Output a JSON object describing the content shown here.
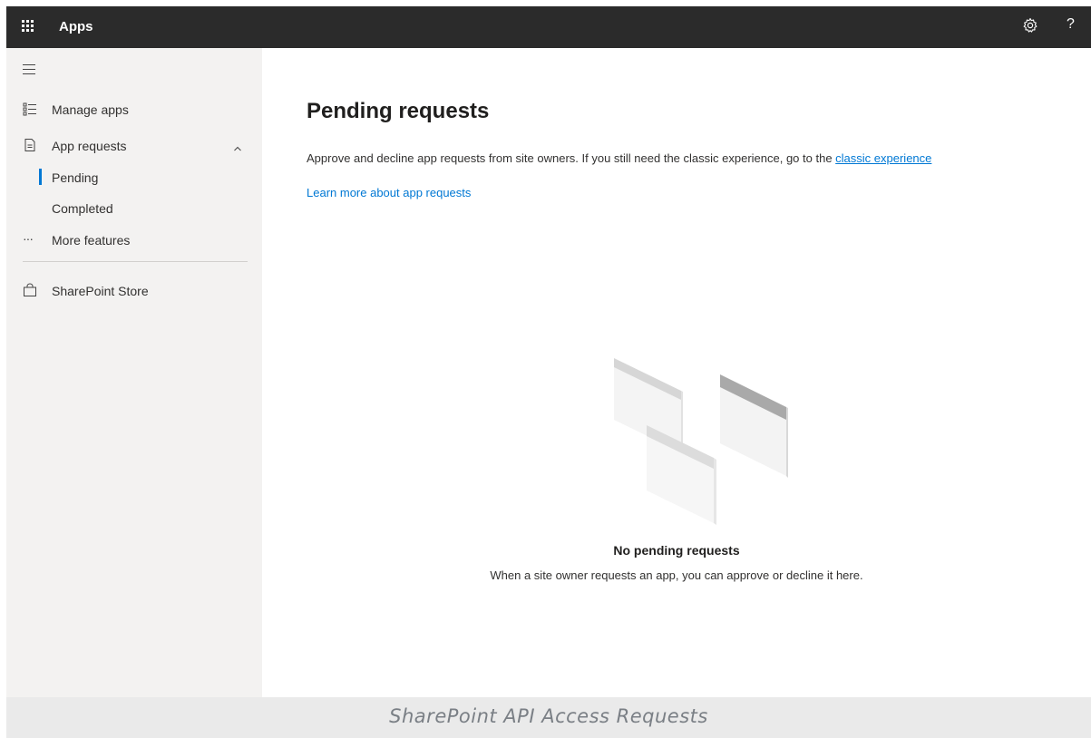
{
  "topbar": {
    "title": "Apps",
    "icons": [
      "app-launcher-icon",
      "settings-gear-icon",
      "help-icon"
    ],
    "help_glyph": "?"
  },
  "sidebar": {
    "items": [
      {
        "label": "Manage apps",
        "icon": "list-icon"
      },
      {
        "label": "App requests",
        "icon": "document-icon",
        "expanded": true
      },
      {
        "label": "Pending",
        "active": true
      },
      {
        "label": "Completed"
      },
      {
        "label": "More features",
        "icon": "more-dots-icon",
        "glyph": "···"
      },
      {
        "label": "SharePoint Store",
        "icon": "shopping-bag-icon"
      }
    ]
  },
  "main": {
    "title": "Pending requests",
    "description": "Approve and decline app requests from site owners. If you still need the classic experience, go to the ",
    "classic_link": "classic experience",
    "learn_more": "Learn more about app requests",
    "empty_title": "No pending requests",
    "empty_subtitle": "When a site owner requests an app, you can approve or decline it here."
  },
  "caption": "SharePoint API Access Requests",
  "colors": {
    "topbar": "#2b2b2b",
    "sidebar": "#f3f2f1",
    "accent": "#0078d4"
  }
}
